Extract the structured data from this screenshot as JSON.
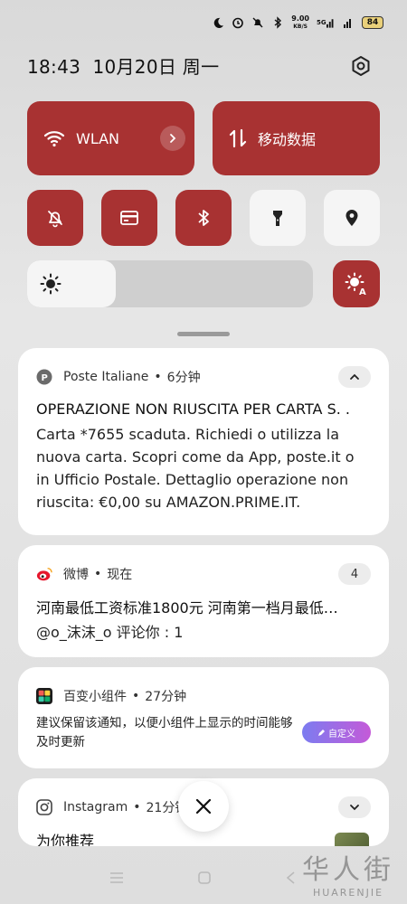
{
  "status_bar": {
    "net_speed_value": "9.00",
    "net_speed_unit": "KB/S",
    "signal_label": "5G",
    "battery": "84"
  },
  "header": {
    "time_date": "18:43  10月20日 周一"
  },
  "tiles": {
    "wlan_label": "WLAN",
    "mobile_data_label": "移动数据"
  },
  "brightness": {
    "level": 0.31
  },
  "notifications": [
    {
      "app": "Poste Italiane",
      "time": "6分钟",
      "title": "OPERAZIONE NON RIUSCITA PER CARTA S. .",
      "body": "Carta *7655 scaduta. Richiedi o utilizza la nuova carta. Scopri come da App, poste.it o in Ufficio Postale. Dettaglio operazione non riuscita: €0,00 su AMAZON.PRIME.IT."
    },
    {
      "app": "微博",
      "time": "现在",
      "count": "4",
      "title": "河南最低工资标准1800元 河南第一档月最低…",
      "body": "@o_沫沫_o 评论你 : 1"
    },
    {
      "app": "百变小组件",
      "time": "27分钟",
      "body": "建议保留该通知，以便小组件上显示的时间能够及时更新",
      "button": "自定义"
    },
    {
      "app": "Instagram",
      "time": "21分钟",
      "title": "为你推荐"
    }
  ],
  "watermark": {
    "cn": "华人街",
    "en": "HUARENJIE"
  },
  "colors": {
    "accent": "#a83232",
    "card": "#ffffff"
  }
}
